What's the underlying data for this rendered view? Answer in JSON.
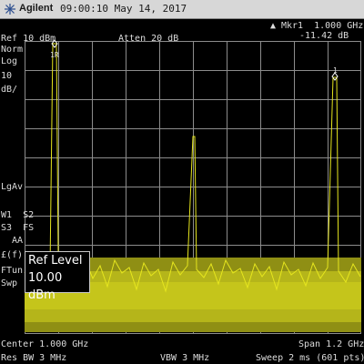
{
  "header": {
    "brand": "Agilent",
    "timestamp": "09:00:10  May 14, 2017",
    "marker_readout": "Mkr1  1.000 GHz",
    "marker_value": "-11.42 dB"
  },
  "settings": {
    "ref": "Ref 10 dBm",
    "atten": "Atten 20 dB"
  },
  "left_panel": {
    "detector": "Norm",
    "scale_type": "Log",
    "scale_value": "10",
    "scale_units": "dB/",
    "avg": "LgAv",
    "trace_line1": "W1  S2",
    "trace_line2": "S3  FS",
    "trace_line3": "AA",
    "ff": "£(f):",
    "ftun": "FTun",
    "swp": "Swp"
  },
  "markers": {
    "m1r_label": "1R",
    "m1_label": "1"
  },
  "ref_level_popup": {
    "label": "Ref Level",
    "value": "10.00 dBm"
  },
  "footer": {
    "center": "Center 1.000 GHz",
    "span": "Span 1.2 GHz",
    "res_bw": "Res BW 3 MHz",
    "vbw": "VBW 3 MHz",
    "sweep": "Sweep 2 ms (601 pts)"
  },
  "colors": {
    "trace": "#e6e61e",
    "grid": "#8c8c8c",
    "background": "#000000"
  }
}
